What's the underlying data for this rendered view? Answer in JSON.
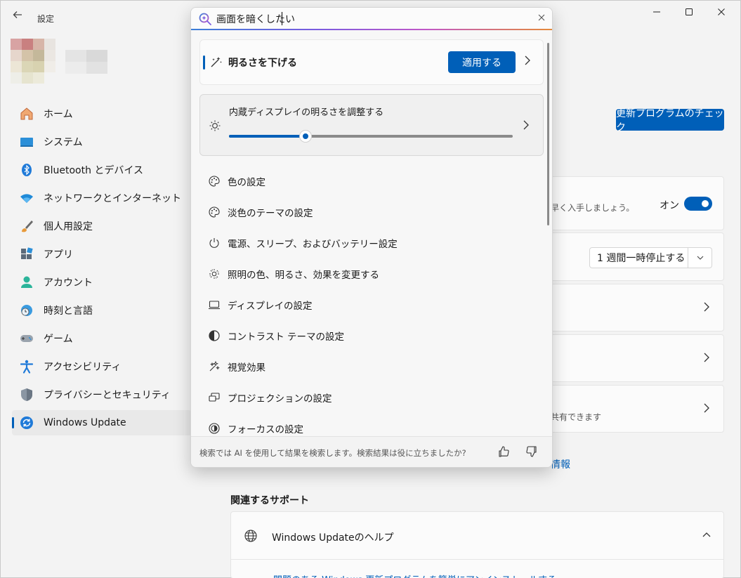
{
  "app": {
    "title": "設定"
  },
  "window_controls": {
    "minimize": "—",
    "maximize": "☐",
    "close": "✕"
  },
  "sidebar": {
    "items": [
      {
        "label": "ホーム",
        "icon": "home-icon"
      },
      {
        "label": "システム",
        "icon": "system-icon"
      },
      {
        "label": "Bluetooth とデバイス",
        "icon": "bluetooth-icon"
      },
      {
        "label": "ネットワークとインターネット",
        "icon": "wifi-icon"
      },
      {
        "label": "個人用設定",
        "icon": "brush-icon"
      },
      {
        "label": "アプリ",
        "icon": "apps-icon"
      },
      {
        "label": "アカウント",
        "icon": "account-icon"
      },
      {
        "label": "時刻と言語",
        "icon": "time-language-icon"
      },
      {
        "label": "ゲーム",
        "icon": "gamepad-icon"
      },
      {
        "label": "アクセシビリティ",
        "icon": "accessibility-icon"
      },
      {
        "label": "プライバシーとセキュリティ",
        "icon": "shield-icon"
      },
      {
        "label": "Windows Update",
        "icon": "update-icon",
        "active": true
      }
    ]
  },
  "main": {
    "check_updates_button": "更新プログラムのチェック",
    "card1": {
      "desc_fragment": "早く入手しましょう。",
      "toggle_label": "オン",
      "toggle_on": true
    },
    "card2": {
      "pause_select": "1 週間一時停止する"
    },
    "card5": {
      "desc_fragment": "共有できます"
    },
    "more_info_link": "情報",
    "support_title": "関連するサポート",
    "help": {
      "label": "Windows Updateのヘルプ",
      "link_fragment": "問題のある Windows 更新プログラムを簡単にアンインストールする"
    }
  },
  "search": {
    "query": "画面を暗くしたい",
    "top_result": {
      "label": "明るさを下げる",
      "apply_button": "適用する"
    },
    "brightness": {
      "label": "内蔵ディスプレイの明るさを調整する",
      "value": 0.27
    },
    "results": [
      {
        "label": "色の設定",
        "icon": "palette-icon"
      },
      {
        "label": "淡色のテーマの設定",
        "icon": "palette-icon"
      },
      {
        "label": "電源、スリープ、およびバッテリー設定",
        "icon": "power-icon"
      },
      {
        "label": "照明の色、明るさ、効果を変更する",
        "icon": "lighting-icon"
      },
      {
        "label": "ディスプレイの設定",
        "icon": "display-icon"
      },
      {
        "label": "コントラスト テーマの設定",
        "icon": "contrast-icon"
      },
      {
        "label": "視覚効果",
        "icon": "sparkle-icon"
      },
      {
        "label": "プロジェクションの設定",
        "icon": "projection-icon"
      },
      {
        "label": "フォーカスの設定",
        "icon": "focus-icon"
      }
    ],
    "footer_text": "検索では AI を使用して結果を検索します。検索結果は役に立ちましたか?"
  },
  "colors": {
    "accent": "#005fb8"
  }
}
